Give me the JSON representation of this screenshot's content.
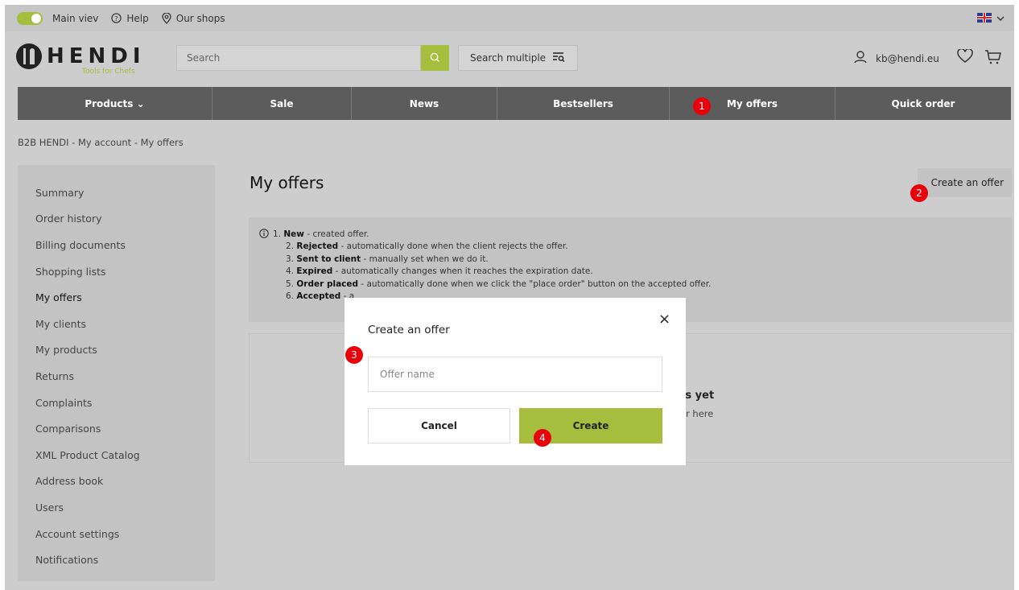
{
  "topbar": {
    "main_view": "Main viev",
    "help": "Help",
    "shops": "Our shops"
  },
  "header": {
    "logo_text": "HENDI",
    "logo_sub": "Tools for Chefs",
    "search_placeholder": "Search",
    "search_multiple": "Search multiple",
    "account_email": "kb@hendi.eu"
  },
  "nav": {
    "items": [
      {
        "label": "Products ⌄"
      },
      {
        "label": "Sale"
      },
      {
        "label": "News"
      },
      {
        "label": "Bestsellers"
      },
      {
        "label": "My offers"
      },
      {
        "label": "Quick order"
      }
    ]
  },
  "breadcrumb": "B2B HENDI  -  My account  -  My offers",
  "sidebar": {
    "items": [
      {
        "label": "Summary"
      },
      {
        "label": "Order history"
      },
      {
        "label": "Billing documents"
      },
      {
        "label": "Shopping lists"
      },
      {
        "label": "My offers"
      },
      {
        "label": "My clients"
      },
      {
        "label": "My products"
      },
      {
        "label": "Returns"
      },
      {
        "label": "Complaints"
      },
      {
        "label": "Comparisons"
      },
      {
        "label": "XML Product Catalog"
      },
      {
        "label": "Address book"
      },
      {
        "label": "Users"
      },
      {
        "label": "Account settings"
      },
      {
        "label": "Notifications"
      }
    ]
  },
  "main": {
    "title": "My offers",
    "create_offer": "Create an offer",
    "info": [
      {
        "num": "1.",
        "bold": "New",
        "text": " - created offer."
      },
      {
        "num": "2.",
        "bold": "Rejected",
        "text": " - automatically done when the client rejects the offer."
      },
      {
        "num": "3.",
        "bold": "Sent to client",
        "text": " - manually set when we do it."
      },
      {
        "num": "4.",
        "bold": "Expired",
        "text": " - automatically changes when it reaches the expiration date."
      },
      {
        "num": "5.",
        "bold": "Order placed",
        "text": " - automatically done when we click the \"place order\" button on the accepted offer."
      },
      {
        "num": "6.",
        "bold": "Accepted",
        "text": " - a"
      }
    ],
    "empty_title": "rs yet",
    "empty_sub": "ar here"
  },
  "modal": {
    "title": "Create an offer",
    "close": "×",
    "input_placeholder": "Offer name",
    "cancel": "Cancel",
    "create": "Create"
  },
  "badges": [
    "1",
    "2",
    "3",
    "4"
  ],
  "colors": {
    "accent": "#a6bd3d",
    "nav_bg": "#5c5c5c",
    "badge": "#e8000b"
  }
}
